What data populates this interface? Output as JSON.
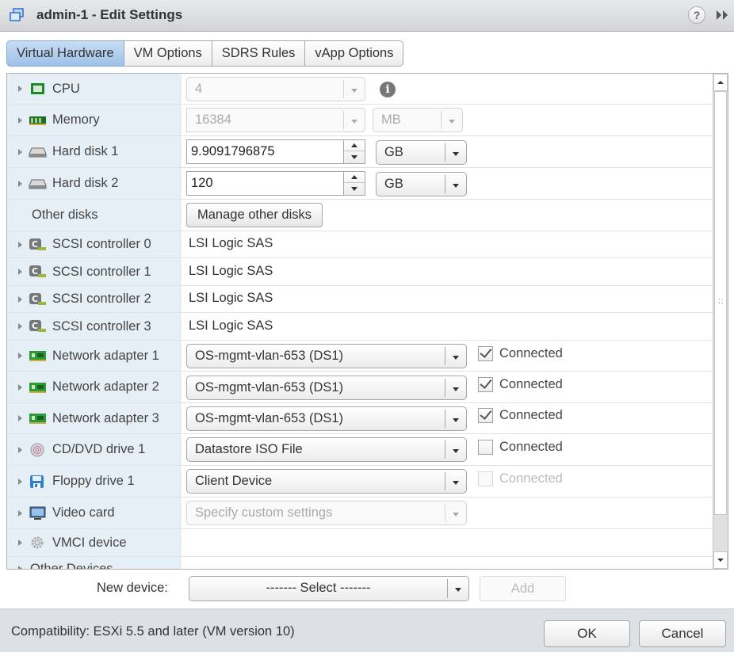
{
  "window": {
    "title": "admin-1 - Edit Settings",
    "help_label": "?",
    "expand_label": "▸▸"
  },
  "tabs": [
    {
      "label": "Virtual Hardware",
      "active": true
    },
    {
      "label": "VM Options",
      "active": false
    },
    {
      "label": "SDRS Rules",
      "active": false
    },
    {
      "label": "vApp Options",
      "active": false
    }
  ],
  "hardware": {
    "cpu": {
      "label": "CPU",
      "value": "4",
      "info_icon": "i"
    },
    "memory": {
      "label": "Memory",
      "value": "16384",
      "unit": "MB"
    },
    "hard_disk_1": {
      "label": "Hard disk 1",
      "value": "9.9091796875",
      "unit": "GB"
    },
    "hard_disk_2": {
      "label": "Hard disk 2",
      "value": "120",
      "unit": "GB"
    },
    "other_disks": {
      "label": "Other disks",
      "button": "Manage other disks"
    },
    "scsi": [
      {
        "label": "SCSI controller 0",
        "value": "LSI Logic SAS"
      },
      {
        "label": "SCSI controller 1",
        "value": "LSI Logic SAS"
      },
      {
        "label": "SCSI controller 2",
        "value": "LSI Logic SAS"
      },
      {
        "label": "SCSI controller 3",
        "value": "LSI Logic SAS"
      }
    ],
    "network": [
      {
        "label": "Network adapter 1",
        "value": "OS-mgmt-vlan-653 (DS1)",
        "connected_label": "Connected",
        "connected": true
      },
      {
        "label": "Network adapter 2",
        "value": "OS-mgmt-vlan-653 (DS1)",
        "connected_label": "Connected",
        "connected": true
      },
      {
        "label": "Network adapter 3",
        "value": "OS-mgmt-vlan-653 (DS1)",
        "connected_label": "Connected",
        "connected": true
      }
    ],
    "cdrom": {
      "label": "CD/DVD drive 1",
      "value": "Datastore ISO File",
      "connected_label": "Connected",
      "connected": false
    },
    "floppy": {
      "label": "Floppy drive 1",
      "value": "Client Device",
      "connected_label": "Connected",
      "connected": false,
      "disabled": true
    },
    "video": {
      "label": "Video card",
      "value": "Specify custom settings"
    },
    "vmci": {
      "label": "VMCI device"
    },
    "other_devices": {
      "label": "Other Devices"
    }
  },
  "new_device": {
    "label": "New device:",
    "selected": "------- Select -------",
    "add_label": "Add"
  },
  "footer": {
    "compatibility": "Compatibility: ESXi 5.5 and later (VM version 10)",
    "ok_label": "OK",
    "cancel_label": "Cancel"
  },
  "colors": {
    "active_tab": "#9ec1e6",
    "label_column": "#e6eef6",
    "footer_bg": "#dde1e6"
  }
}
